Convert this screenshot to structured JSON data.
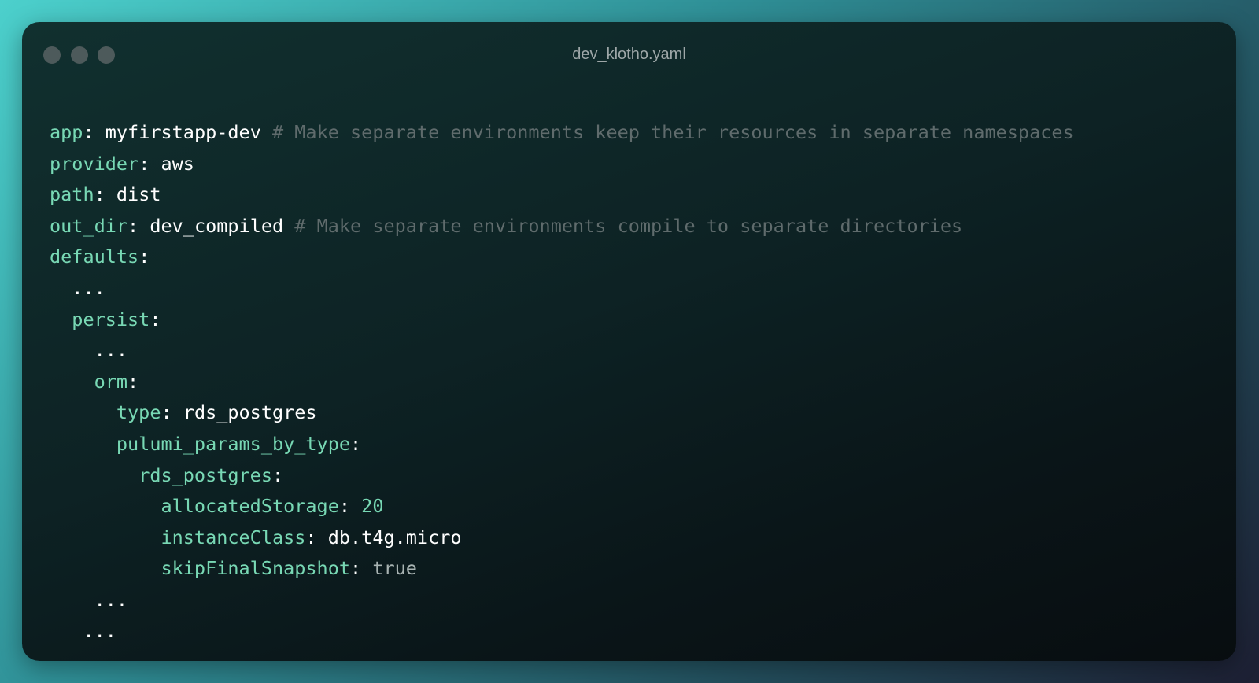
{
  "window": {
    "title": "dev_klotho.yaml"
  },
  "code": {
    "lines": [
      {
        "indent": "",
        "key": "app",
        "value": "myfirstapp-dev",
        "value_kind": "string",
        "comment": " # Make separate environments keep their resources in separate namespaces"
      },
      {
        "indent": "",
        "key": "provider",
        "value": "aws",
        "value_kind": "string",
        "comment": ""
      },
      {
        "indent": "",
        "key": "path",
        "value": "dist",
        "value_kind": "string",
        "comment": ""
      },
      {
        "indent": "",
        "key": "out_dir",
        "value": "dev_compiled",
        "value_kind": "string",
        "comment": " # Make separate environments compile to separate directories"
      },
      {
        "indent": "",
        "key": "defaults",
        "value": "",
        "value_kind": "none",
        "comment": ""
      },
      {
        "indent": "  ",
        "text": "..."
      },
      {
        "indent": "  ",
        "key": "persist",
        "value": "",
        "value_kind": "none",
        "comment": ""
      },
      {
        "indent": "    ",
        "text": "..."
      },
      {
        "indent": "    ",
        "key": "orm",
        "value": "",
        "value_kind": "none",
        "comment": ""
      },
      {
        "indent": "      ",
        "key": "type",
        "value": "rds_postgres",
        "value_kind": "string",
        "comment": ""
      },
      {
        "indent": "      ",
        "key": "pulumi_params_by_type",
        "value": "",
        "value_kind": "none",
        "comment": ""
      },
      {
        "indent": "        ",
        "key": "rds_postgres",
        "value": "",
        "value_kind": "none",
        "comment": ""
      },
      {
        "indent": "          ",
        "key": "allocatedStorage",
        "value": "20",
        "value_kind": "number",
        "comment": ""
      },
      {
        "indent": "          ",
        "key": "instanceClass",
        "value": "db.t4g.micro",
        "value_kind": "string",
        "comment": ""
      },
      {
        "indent": "          ",
        "key": "skipFinalSnapshot",
        "value": "true",
        "value_kind": "bool",
        "comment": ""
      },
      {
        "indent": "    ",
        "text": "..."
      },
      {
        "indent": "   ",
        "text": "..."
      }
    ]
  },
  "colors": {
    "key": "#78d8b4",
    "string": "#ffffff",
    "number": "#78d8b4",
    "bool": "#a9b4b3",
    "comment": "#5f6b6c"
  }
}
